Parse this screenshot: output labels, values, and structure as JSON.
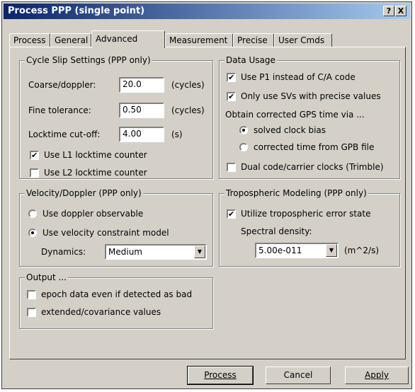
{
  "window": {
    "title": "Process PPP (single point)",
    "help_glyph": "?",
    "close_glyph": "X"
  },
  "tabs": [
    "Process",
    "General",
    "Advanced",
    "Measurement",
    "Precise",
    "User Cmds"
  ],
  "active_tab": "Advanced",
  "cycle_slip": {
    "title": "Cycle Slip Settings (PPP only)",
    "coarse_label": "Coarse/doppler:",
    "coarse_value": "20.0",
    "coarse_unit": "(cycles)",
    "fine_label": "Fine tolerance:",
    "fine_value": "0.50",
    "fine_unit": "(cycles)",
    "locktime_label": "Locktime cut-off:",
    "locktime_value": "4.00",
    "locktime_unit": "(s)",
    "l1_label": "Use L1 locktime counter",
    "l1_checked": true,
    "l2_label": "Use L2 locktime counter",
    "l2_checked": false
  },
  "data_usage": {
    "title": "Data Usage",
    "p1_label": "Use P1 instead of C/A code",
    "p1_checked": true,
    "svs_label": "Only use SVs with precise values",
    "svs_checked": true,
    "gps_time_label": "Obtain corrected GPS time via ...",
    "radio_solved": "solved clock bias",
    "radio_solved_selected": true,
    "radio_gpb": "corrected time from GPB file",
    "radio_gpb_selected": false,
    "dual_label": "Dual code/carrier clocks (Trimble)",
    "dual_checked": false
  },
  "velocity": {
    "title": "Velocity/Doppler (PPP only)",
    "doppler_label": "Use doppler observable",
    "doppler_selected": false,
    "constraint_label": "Use velocity constraint model",
    "constraint_selected": true,
    "dynamics_label": "Dynamics:",
    "dynamics_value": "Medium"
  },
  "tropo": {
    "title": "Tropospheric Modeling (PPP only)",
    "utilize_label": "Utilize tropospheric error state",
    "utilize_checked": true,
    "spectral_label": "Spectral density:",
    "spectral_value": "5.00e-011",
    "spectral_unit": "(m^2/s)"
  },
  "output": {
    "title": "Output ...",
    "epoch_label": "epoch data even if detected as bad",
    "epoch_checked": false,
    "extended_label": "extended/covariance values",
    "extended_checked": false
  },
  "buttons": {
    "process": "Process",
    "cancel": "Cancel",
    "apply": "Apply"
  },
  "icons": {
    "check": "check-mark",
    "dropdown": "chevron-down-icon"
  }
}
